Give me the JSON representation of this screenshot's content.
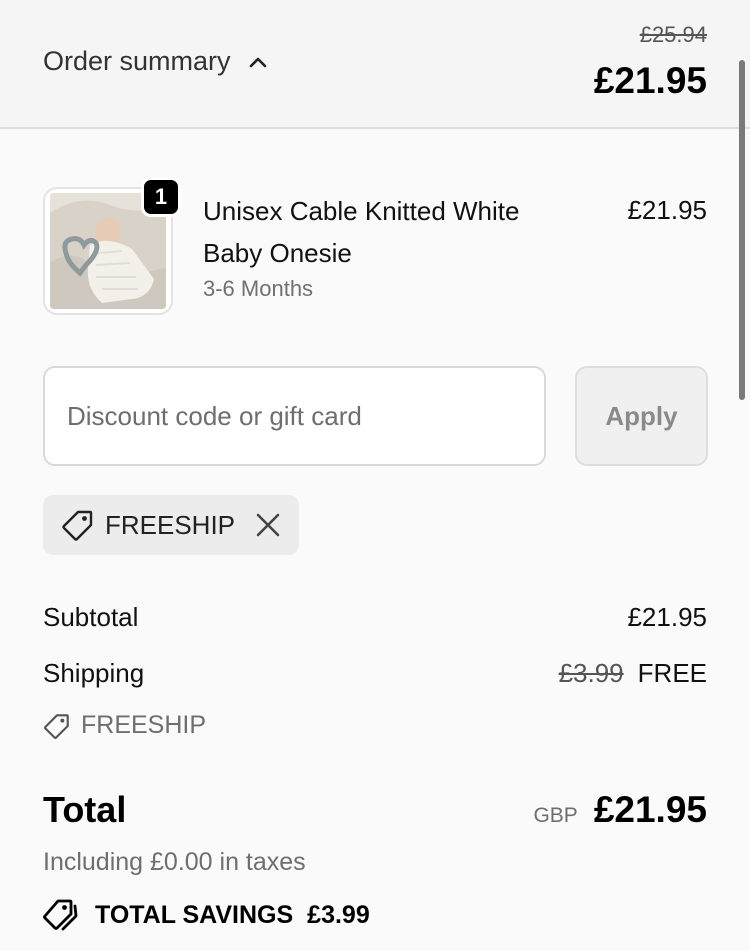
{
  "header": {
    "toggle_label": "Order summary",
    "original_total": "£25.94",
    "current_total": "£21.95"
  },
  "product": {
    "quantity": "1",
    "name": "Unisex Cable Knitted White Baby Onesie",
    "variant": "3-6 Months",
    "price": "£21.95",
    "image_alt": "Baby in white knitted onesie with teether"
  },
  "discount": {
    "placeholder": "Discount code or gift card",
    "apply_label": "Apply",
    "applied_code": "FREESHIP"
  },
  "summary": {
    "subtotal_label": "Subtotal",
    "subtotal_value": "£21.95",
    "shipping_label": "Shipping",
    "shipping_original": "£3.99",
    "shipping_value": "FREE",
    "shipping_code": "FREESHIP",
    "total_label": "Total",
    "currency": "GBP",
    "total_value": "£21.95",
    "taxes_note": "Including £0.00 in taxes",
    "savings_label": "TOTAL SAVINGS",
    "savings_value": "£3.99"
  },
  "icons": {
    "chevron": "chevron-up-icon",
    "tag": "tag-icon",
    "close": "close-icon",
    "savings": "tags-icon"
  },
  "colors": {
    "accent": "#000000",
    "muted_text": "#6e6e6e",
    "chip_bg": "#ececec"
  }
}
